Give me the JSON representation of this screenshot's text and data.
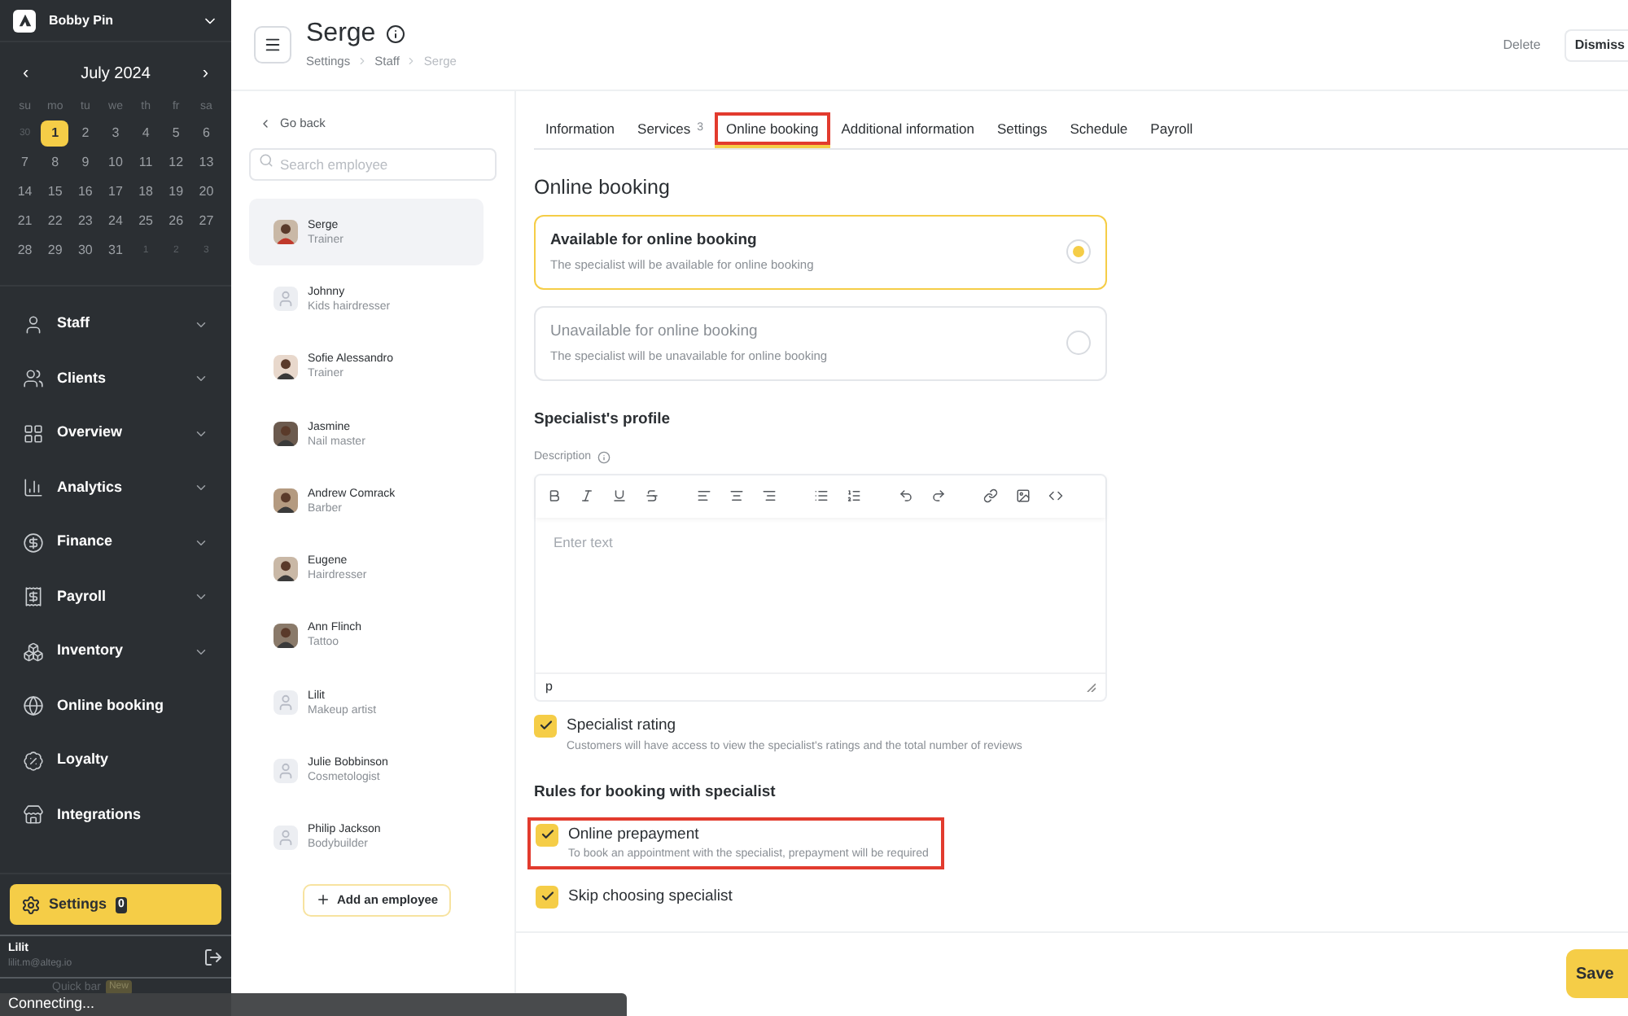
{
  "sidebar": {
    "company": "Bobby Pin",
    "calendar": {
      "month": "July 2024",
      "prev": "‹",
      "next": "›",
      "weekdays": [
        "su",
        "mo",
        "tu",
        "we",
        "th",
        "fr",
        "sa"
      ],
      "weeks": [
        [
          {
            "day": "30",
            "outside": true,
            "selected": false
          },
          {
            "day": "1",
            "outside": false,
            "selected": true
          },
          {
            "day": "2",
            "outside": false,
            "selected": false
          },
          {
            "day": "3",
            "outside": false,
            "selected": false
          },
          {
            "day": "4",
            "outside": false,
            "selected": false
          },
          {
            "day": "5",
            "outside": false,
            "selected": false
          },
          {
            "day": "6",
            "outside": false,
            "selected": false
          }
        ],
        [
          {
            "day": "7",
            "outside": false,
            "selected": false
          },
          {
            "day": "8",
            "outside": false,
            "selected": false
          },
          {
            "day": "9",
            "outside": false,
            "selected": false
          },
          {
            "day": "10",
            "outside": false,
            "selected": false
          },
          {
            "day": "11",
            "outside": false,
            "selected": false
          },
          {
            "day": "12",
            "outside": false,
            "selected": false
          },
          {
            "day": "13",
            "outside": false,
            "selected": false
          }
        ],
        [
          {
            "day": "14",
            "outside": false,
            "selected": false
          },
          {
            "day": "15",
            "outside": false,
            "selected": false
          },
          {
            "day": "16",
            "outside": false,
            "selected": false
          },
          {
            "day": "17",
            "outside": false,
            "selected": false
          },
          {
            "day": "18",
            "outside": false,
            "selected": false
          },
          {
            "day": "19",
            "outside": false,
            "selected": false
          },
          {
            "day": "20",
            "outside": false,
            "selected": false
          }
        ],
        [
          {
            "day": "21",
            "outside": false,
            "selected": false
          },
          {
            "day": "22",
            "outside": false,
            "selected": false
          },
          {
            "day": "23",
            "outside": false,
            "selected": false
          },
          {
            "day": "24",
            "outside": false,
            "selected": false
          },
          {
            "day": "25",
            "outside": false,
            "selected": false
          },
          {
            "day": "26",
            "outside": false,
            "selected": false
          },
          {
            "day": "27",
            "outside": false,
            "selected": false
          }
        ],
        [
          {
            "day": "28",
            "outside": false,
            "selected": false
          },
          {
            "day": "29",
            "outside": false,
            "selected": false
          },
          {
            "day": "30",
            "outside": false,
            "selected": false
          },
          {
            "day": "31",
            "outside": false,
            "selected": false
          },
          {
            "day": "1",
            "outside": true,
            "selected": false
          },
          {
            "day": "2",
            "outside": true,
            "selected": false
          },
          {
            "day": "3",
            "outside": true,
            "selected": false
          }
        ]
      ]
    },
    "items": [
      {
        "kind": "staff",
        "label": "Staff",
        "expandable": true
      },
      {
        "kind": "clients",
        "label": "Clients",
        "expandable": true
      },
      {
        "kind": "overview",
        "label": "Overview",
        "expandable": true
      },
      {
        "kind": "analytics",
        "label": "Analytics",
        "expandable": true
      },
      {
        "kind": "finance",
        "label": "Finance",
        "expandable": true
      },
      {
        "kind": "payroll",
        "label": "Payroll",
        "expandable": true
      },
      {
        "kind": "inventory",
        "label": "Inventory",
        "expandable": true
      },
      {
        "kind": "booking",
        "label": "Online booking",
        "expandable": false
      },
      {
        "kind": "loyalty",
        "label": "Loyalty",
        "expandable": false
      },
      {
        "kind": "integrations",
        "label": "Integrations",
        "expandable": false
      }
    ],
    "settings": {
      "label": "Settings",
      "badge": "0"
    },
    "user": {
      "name": "Lilit",
      "email": "lilit.m@alteg.io"
    },
    "quick_bar": {
      "label": "Quick bar",
      "badge": "New"
    }
  },
  "header": {
    "title": "Serge",
    "breadcrumbs": [
      "Settings",
      "Staff",
      "Serge"
    ],
    "delete": "Delete",
    "dismiss": "Dismiss"
  },
  "employees": {
    "back": "Go back",
    "search": {
      "placeholder": "Search employee"
    },
    "list": [
      {
        "name": "Serge",
        "role": "Trainer",
        "selected": true
      },
      {
        "name": "Johnny",
        "role": "Kids hairdresser",
        "kind": "placeholder",
        "selected": false
      },
      {
        "name": "Sofie Alessandro",
        "role": "Trainer",
        "selected": false
      },
      {
        "name": "Jasmine",
        "role": "Nail master",
        "selected": false
      },
      {
        "name": "Andrew Comrack",
        "role": "Barber",
        "selected": false
      },
      {
        "name": "Eugene",
        "role": "Hairdresser",
        "selected": false
      },
      {
        "name": "Ann Flinch",
        "role": "Tattoo",
        "selected": false
      },
      {
        "name": "Lilit",
        "role": "Makeup artist",
        "kind": "placeholder",
        "selected": false
      },
      {
        "name": "Julie Bobbinson",
        "role": "Cosmetologist",
        "kind": "placeholder",
        "selected": false
      },
      {
        "name": "Philip Jackson",
        "role": "Bodybuilder",
        "kind": "placeholder",
        "selected": false
      }
    ],
    "add": "Add an employee"
  },
  "tabs": [
    {
      "label": "Information",
      "selected": false,
      "highlighted": false
    },
    {
      "label": "Services",
      "count": "3",
      "selected": false,
      "highlighted": false
    },
    {
      "label": "Online booking",
      "selected": true,
      "highlighted": true
    },
    {
      "label": "Additional information",
      "selected": false,
      "highlighted": false
    },
    {
      "label": "Settings",
      "selected": false,
      "highlighted": false
    },
    {
      "label": "Schedule",
      "selected": false,
      "highlighted": false
    },
    {
      "label": "Payroll",
      "selected": false,
      "highlighted": false
    }
  ],
  "online_booking": {
    "heading": "Online booking",
    "options": [
      {
        "title": "Available for online booking",
        "text": "The specialist will be available for online booking",
        "selected": true
      },
      {
        "title": "Unavailable for online booking",
        "text": "The specialist will be unavailable for online booking",
        "selected": false
      }
    ]
  },
  "profile": {
    "heading": "Specialist's profile",
    "description_label": "Description",
    "editor": {
      "placeholder": "Enter text",
      "path": "p"
    },
    "rating": {
      "label": "Specialist rating",
      "text": "Customers will have access to view the specialist's ratings and the total number of reviews",
      "checked": true
    }
  },
  "rules": {
    "heading": "Rules for booking with specialist",
    "items": [
      {
        "label": "Online prepayment",
        "text": "To book an appointment with the specialist, prepayment will be required",
        "checked": true,
        "highlighted": true
      },
      {
        "label": "Skip choosing specialist",
        "checked": true,
        "highlighted": false
      }
    ]
  },
  "save": "Save",
  "toast": "Connecting..."
}
